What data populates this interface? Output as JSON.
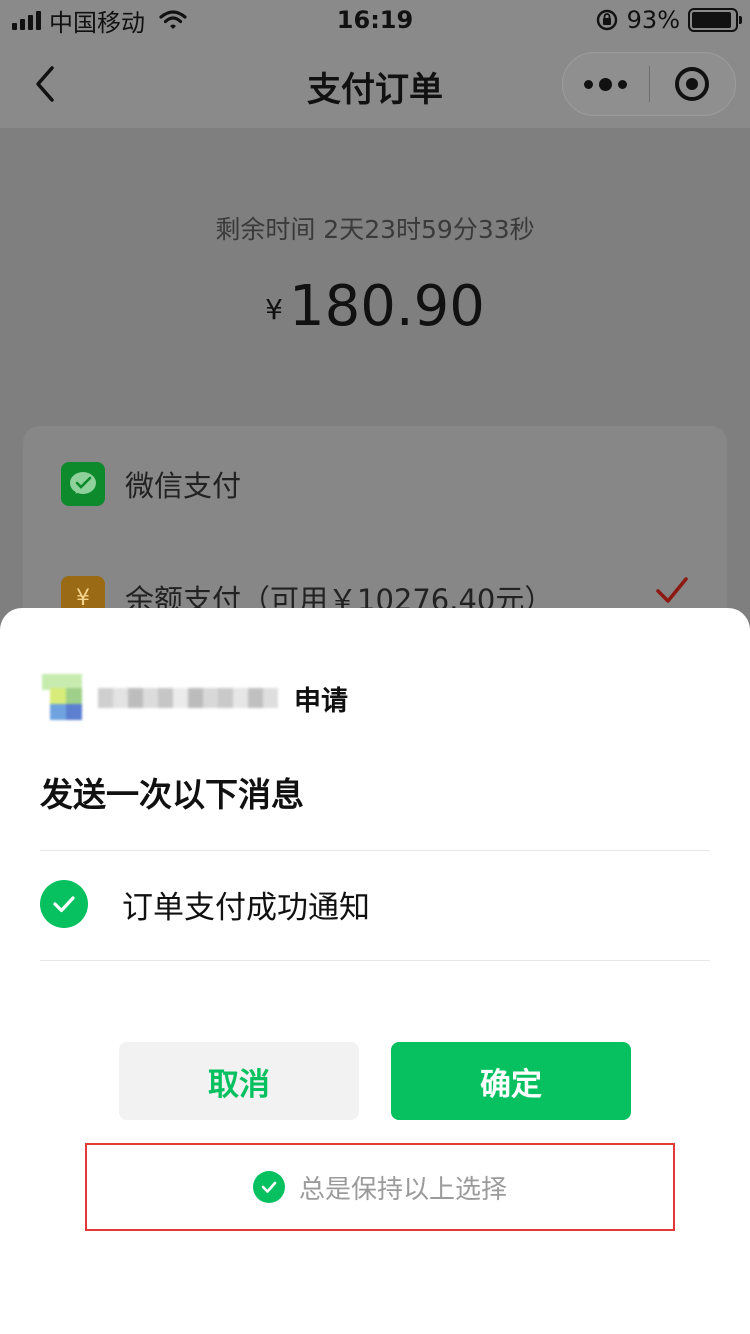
{
  "status_bar": {
    "carrier": "中国移动",
    "time": "16:19",
    "battery": "93%",
    "battery_level": 0.93
  },
  "nav": {
    "title": "支付订单",
    "back_icon": "chevron-left-icon",
    "more_icon": "more-dots-icon",
    "close_icon": "target-circle-icon"
  },
  "order": {
    "countdown": "剩余时间 2天23时59分33秒",
    "currency": "¥",
    "amount": "180.90"
  },
  "payment_methods": [
    {
      "label": "微信支付",
      "icon": "wechat-pay-icon"
    },
    {
      "label": "余额支付（可用￥10276.40元）",
      "icon": "balance-icon",
      "selected": true
    }
  ],
  "sheet": {
    "requester_suffix": "申请",
    "title": "发送一次以下消息",
    "message_item": "订单支付成功通知",
    "cancel_label": "取消",
    "confirm_label": "确定",
    "keep_label": "总是保持以上选择"
  },
  "colors": {
    "accent_green": "#07c160",
    "highlight_red": "#e33a36",
    "overlay": "#7f7f7f"
  }
}
